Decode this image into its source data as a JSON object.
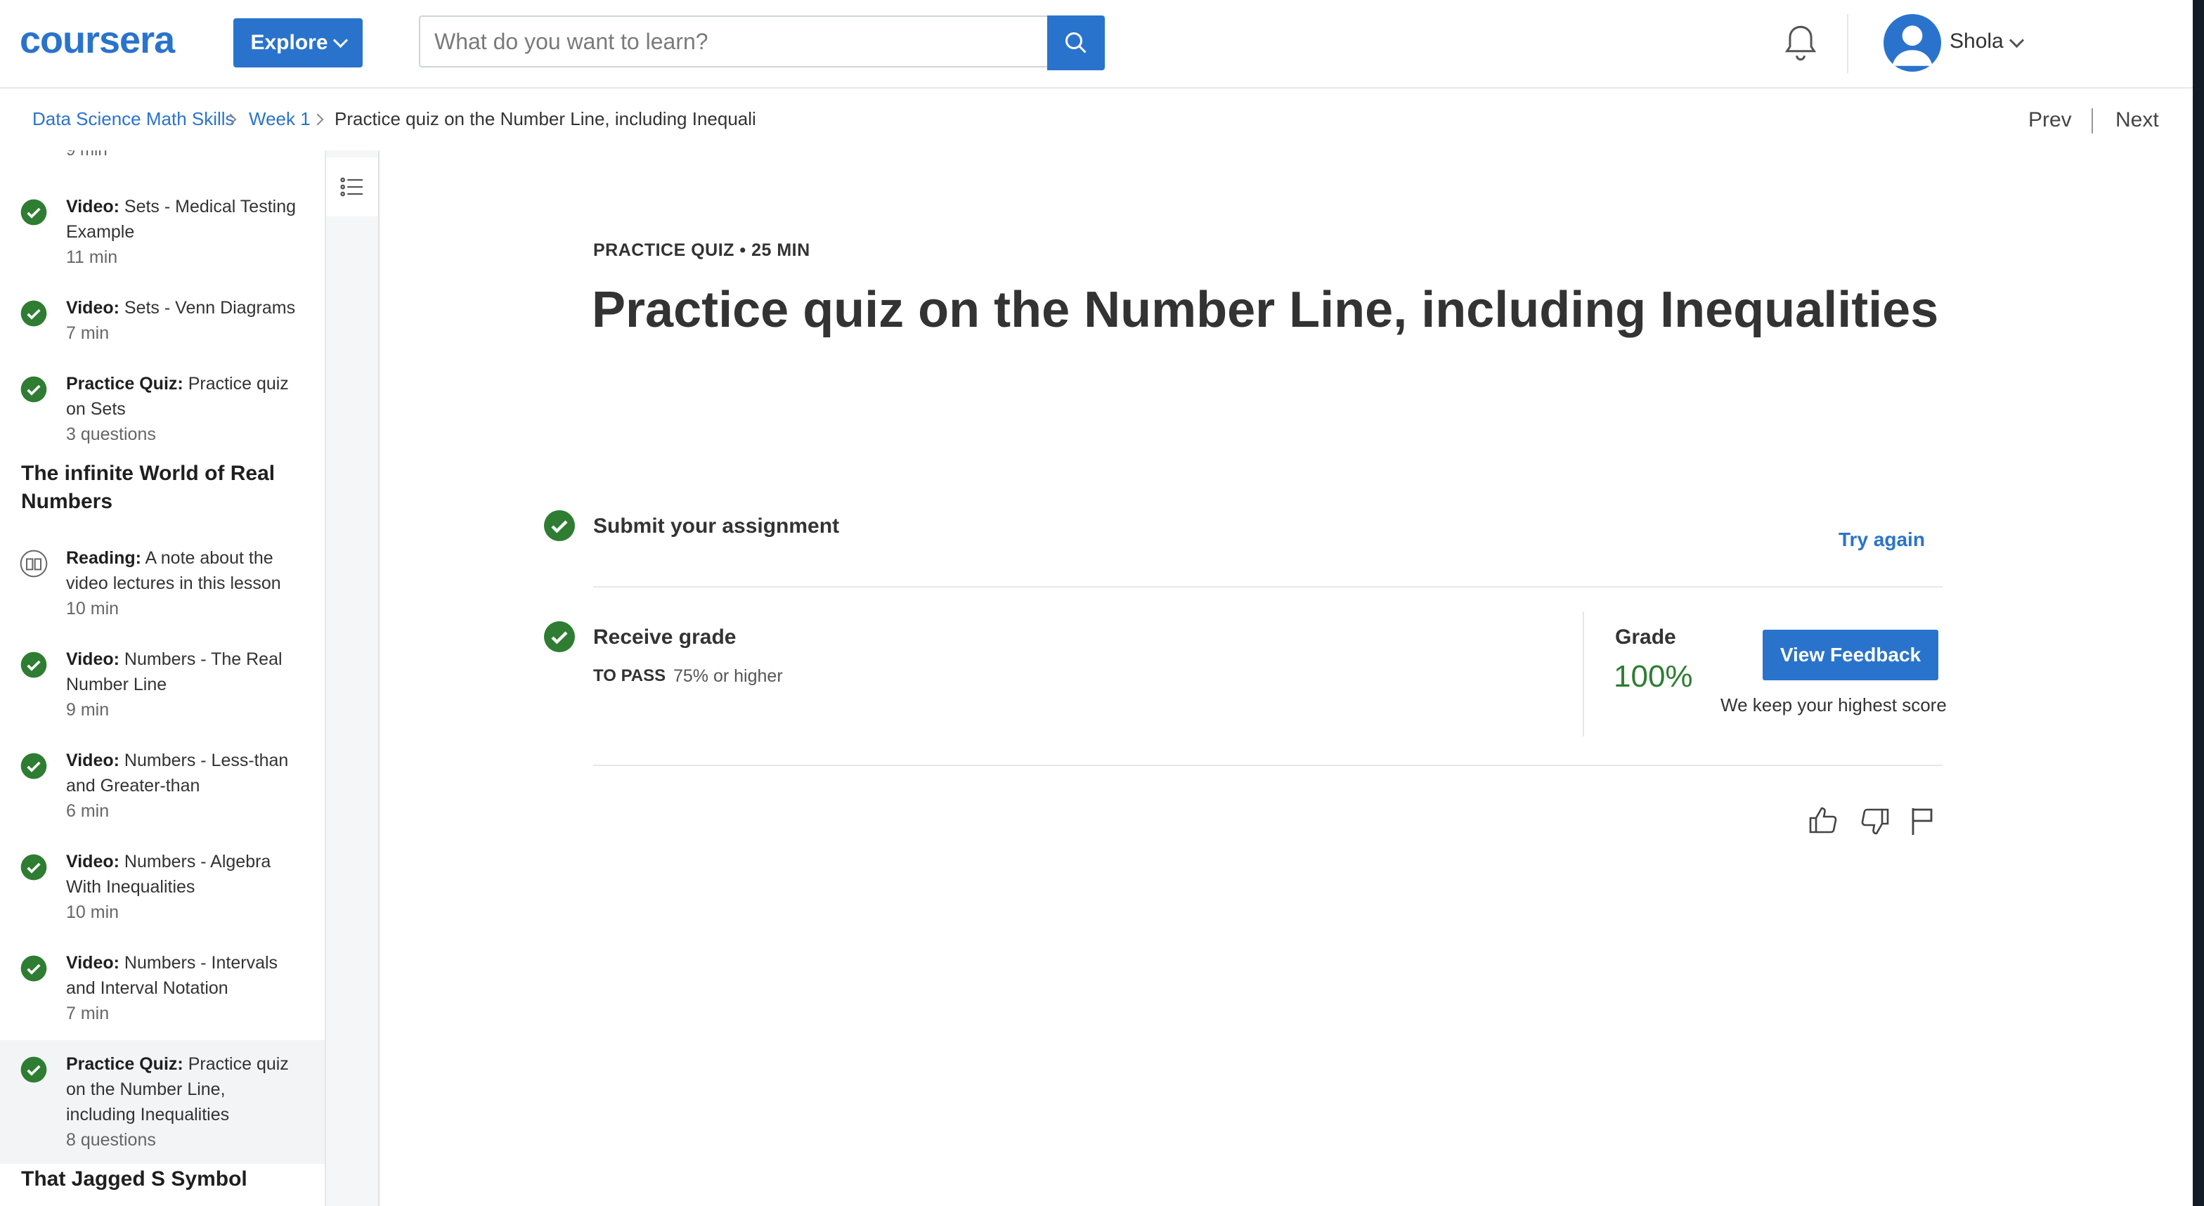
{
  "header": {
    "logo": "coursera",
    "explore_label": "Explore",
    "search_placeholder": "What do you want to learn?",
    "username": "Shola"
  },
  "breadcrumb": {
    "course": "Data Science Math Skills",
    "week": "Week 1",
    "current": "Practice quiz on the Number Line, including Inequaliti",
    "prev": "Prev",
    "next": "Next"
  },
  "sidebar": {
    "partial_top": "9 min",
    "items": [
      {
        "type": "Video:",
        "title": "Sets - Medical Testing Example",
        "meta": "11 min"
      },
      {
        "type": "Video:",
        "title": "Sets - Venn Diagrams",
        "meta": "7 min"
      },
      {
        "type": "Practice Quiz:",
        "title": "Practice quiz on Sets",
        "meta": "3 questions"
      }
    ],
    "section_title": "The infinite World of Real Numbers",
    "items2": [
      {
        "type": "Reading:",
        "title": "A note about the video lectures in this lesson",
        "meta": "10 min"
      },
      {
        "type": "Video:",
        "title": "Numbers - The Real Number Line",
        "meta": "9 min"
      },
      {
        "type": "Video:",
        "title": "Numbers - Less-than and Greater-than",
        "meta": "6 min"
      },
      {
        "type": "Video:",
        "title": "Numbers - Algebra With Inequalities",
        "meta": "10 min"
      },
      {
        "type": "Video:",
        "title": "Numbers - Intervals and Interval Notation",
        "meta": "7 min"
      },
      {
        "type": "Practice Quiz:",
        "title": "Practice quiz on the Number Line, including Inequalities",
        "meta": "8 questions"
      }
    ],
    "next_section_title": "That Jagged S Symbol"
  },
  "main": {
    "eyebrow": "PRACTICE QUIZ • 25 MIN",
    "title": "Practice quiz on the Number Line, including Inequalities",
    "submit_label": "Submit your assignment",
    "try_again": "Try again",
    "receive_label": "Receive grade",
    "to_pass_label": "TO PASS",
    "to_pass_value": "75% or higher",
    "grade_label": "Grade",
    "grade_value": "100%",
    "view_feedback": "View Feedback",
    "keep_note": "We keep your highest score"
  },
  "icons": {
    "completed": "check-circle-icon",
    "reading": "book-icon",
    "like": "thumbs-up-icon",
    "dislike": "thumbs-down-icon",
    "flag": "flag-icon"
  },
  "colors": {
    "brand": "#2a73cc",
    "success": "#2e7d32"
  }
}
